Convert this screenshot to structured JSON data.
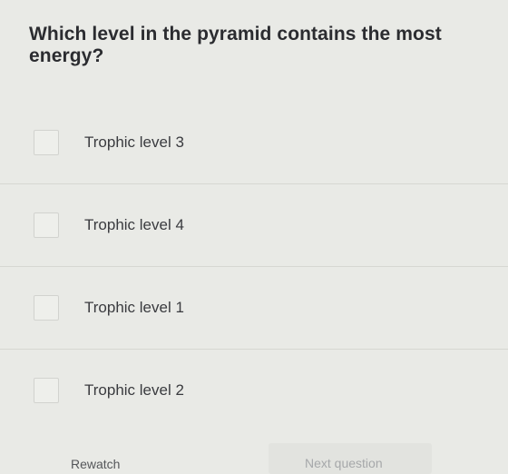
{
  "question": "Which level in the pyramid contains the most energy?",
  "options": [
    {
      "label": "Trophic level 3"
    },
    {
      "label": "Trophic level 4"
    },
    {
      "label": "Trophic level 1"
    },
    {
      "label": "Trophic level 2"
    }
  ],
  "footer": {
    "rewatch_label": "Rewatch",
    "next_label": "Next question"
  }
}
